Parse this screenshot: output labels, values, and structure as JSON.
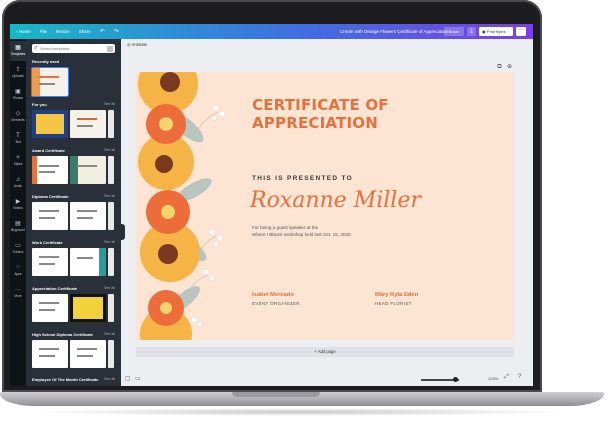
{
  "topbar": {
    "nav": [
      "‹ Home",
      "File",
      "Resize",
      "Share"
    ],
    "doc_title": "Cream with Orange Flowers Certificate of Appreciation",
    "share_label": "Share",
    "download_icon": "download-icon",
    "print_label": "Print flyers",
    "more_icon": "more-icon"
  },
  "rail": [
    {
      "label": "Templates",
      "icon": "templates-icon"
    },
    {
      "label": "Uploads",
      "icon": "uploads-icon"
    },
    {
      "label": "Photos",
      "icon": "photos-icon"
    },
    {
      "label": "Elements",
      "icon": "elements-icon"
    },
    {
      "label": "Text",
      "icon": "text-icon"
    },
    {
      "label": "Styles",
      "icon": "styles-icon"
    },
    {
      "label": "Audio",
      "icon": "audio-icon"
    },
    {
      "label": "Videos",
      "icon": "videos-icon"
    },
    {
      "label": "Bkground",
      "icon": "background-icon"
    },
    {
      "label": "Folders",
      "icon": "folders-icon"
    },
    {
      "label": "Apps",
      "icon": "apps-icon"
    },
    {
      "label": "More",
      "icon": "more-icon"
    }
  ],
  "panel": {
    "search_placeholder": "Search templates",
    "sections": [
      {
        "title": "Recently used",
        "see_all": ""
      },
      {
        "title": "For you",
        "see_all": "See all"
      },
      {
        "title": "Award Certificate",
        "see_all": "See all"
      },
      {
        "title": "Diploma Certificate",
        "see_all": "See all"
      },
      {
        "title": "Work Certificate",
        "see_all": "See all"
      },
      {
        "title": "Appreciation Certificate",
        "see_all": "See all"
      },
      {
        "title": "High School Diploma Certificate",
        "see_all": "See all"
      },
      {
        "title": "Employee Of The Month Certificate",
        "see_all": "See all"
      }
    ]
  },
  "workspace": {
    "animate_label": "Animate",
    "add_page_label": "+ Add page",
    "zoom": "124%"
  },
  "certificate": {
    "title_line1": "CERTIFICATE OF",
    "title_line2": "APPRECIATION",
    "presented_to": "THIS IS PRESENTED TO",
    "recipient": "Roxanne Miller",
    "reason_line1": "For being a guest speaker at the",
    "reason_line2": "Where I Bloom workshop held last Oct. 15, 2020.",
    "signers": [
      {
        "name": "Isabel Mercado",
        "role": "EVENT ORGANIZER"
      },
      {
        "name": "Mary Kyla Eden",
        "role": "HEAD FLORIST"
      }
    ]
  },
  "colors": {
    "accent_orange": "#e8703a",
    "cert_background": "#fde4d3",
    "panel_dark": "#293039",
    "rail_dark": "#0e1318"
  }
}
